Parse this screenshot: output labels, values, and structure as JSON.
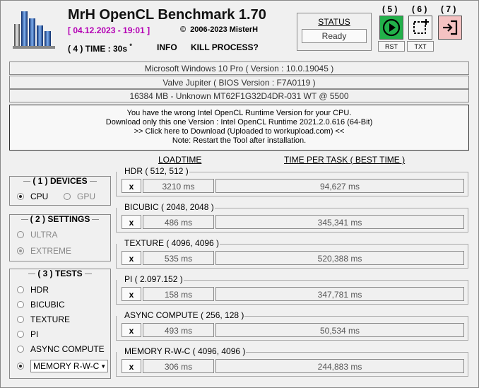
{
  "header": {
    "app_title": "MrH OpenCL Benchmark 1.70",
    "datetime": "[ 04.12.2023 - 19:01 ]",
    "copyright": "2006-2023 MisterH",
    "time_label": "( 4 ) TIME : 30s",
    "time_marker": "*",
    "info_label": "INFO",
    "kill_label": "KILL PROCESS?"
  },
  "status": {
    "label": "STATUS",
    "value": "Ready"
  },
  "buttons": {
    "run": {
      "number": "( 5 )",
      "sub": "RST",
      "color": "#22b04a"
    },
    "capture": {
      "number": "( 6 )",
      "sub": "TXT"
    },
    "exit": {
      "number": "( 7 )",
      "color": "#f4c2c2"
    }
  },
  "system": {
    "os": "Microsoft Windows 10 Pro ( Version : 10.0.19045 )",
    "board": "Valve Jupiter ( BIOS Version : F7A0119 )",
    "memory": "16384 MB - Unknown MT62F1G32D4DR-031 WT @ 5500"
  },
  "message": {
    "line1": "You have the wrong Intel OpenCL Runtime Version for your CPU.",
    "line2": "Download only this one Version : Intel OpenCL Runtime 2021.2.0.616 (64-Bit)",
    "line3": ">> Click here to Download (Uploaded to workupload.com) <<",
    "line4": "Note: Restart the Tool after installation."
  },
  "columns": {
    "loadtime": "LOADTIME",
    "time_per_task": "TIME PER TASK ( BEST TIME )"
  },
  "devices": {
    "title": "( 1 ) DEVICES",
    "cpu": "CPU",
    "gpu": "GPU",
    "selected": "CPU"
  },
  "settings": {
    "title": "( 2 ) SETTINGS",
    "ultra": "ULTRA",
    "extreme": "EXTREME",
    "selected": "EXTREME"
  },
  "tests_panel": {
    "title": "( 3 ) TESTS",
    "items": [
      "HDR",
      "BICUBIC",
      "TEXTURE",
      "PI",
      "ASYNC COMPUTE"
    ],
    "dropdown_value": "MEMORY R-W-C",
    "selected": "MEMORY R-W-C"
  },
  "tests": [
    {
      "name": "HDR ( 512, 512 )",
      "x": "x",
      "loadtime": "3210 ms",
      "time": "94,627 ms"
    },
    {
      "name": "BICUBIC ( 2048, 2048 )",
      "x": "x",
      "loadtime": "486 ms",
      "time": "345,341 ms"
    },
    {
      "name": "TEXTURE ( 4096, 4096 )",
      "x": "x",
      "loadtime": "535 ms",
      "time": "520,388 ms"
    },
    {
      "name": "PI ( 2.097.152 )",
      "x": "x",
      "loadtime": "158 ms",
      "time": "347,781 ms"
    },
    {
      "name": "ASYNC COMPUTE ( 256, 128 )",
      "x": "x",
      "loadtime": "493 ms",
      "time": "50,534 ms"
    },
    {
      "name": "MEMORY R-W-C ( 4096, 4096 )",
      "x": "x",
      "loadtime": "306 ms",
      "time": "244,883 ms"
    }
  ]
}
